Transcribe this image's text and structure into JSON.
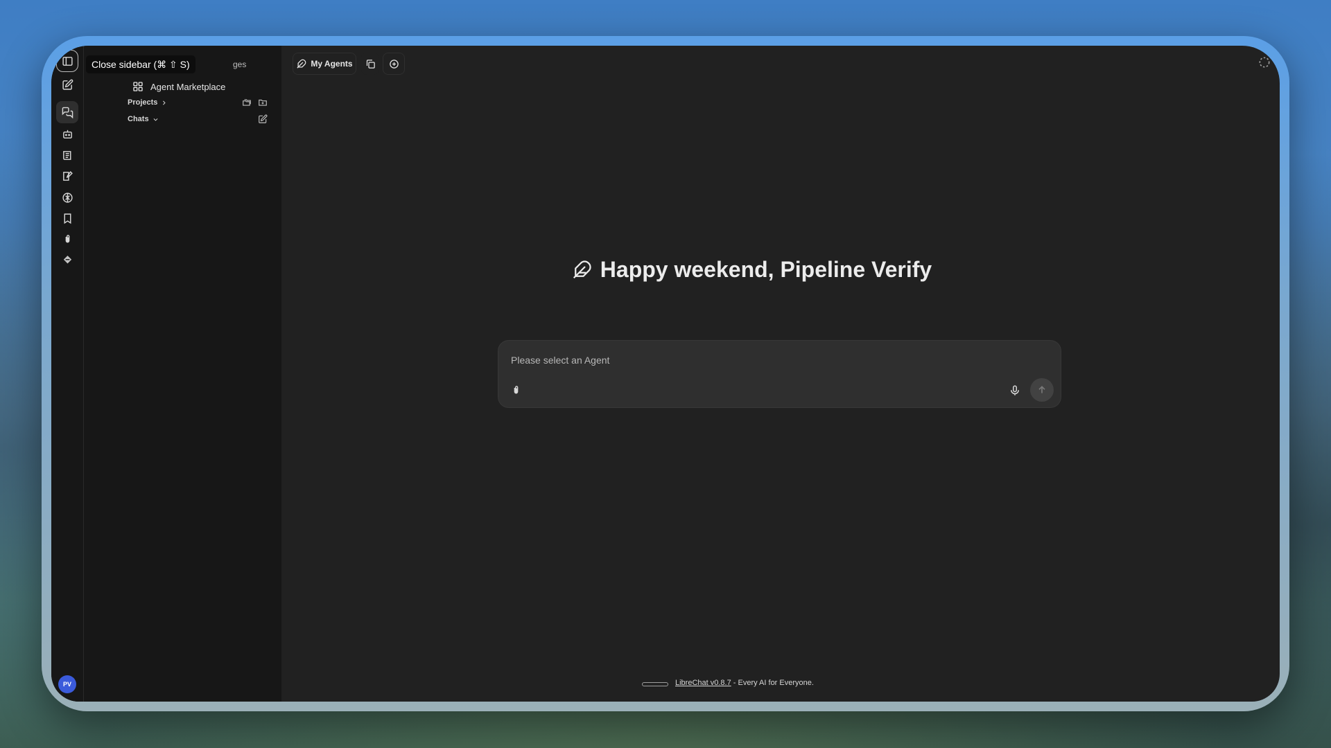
{
  "sidebar": {
    "tooltip": "Close sidebar (⌘ ⇧ S)",
    "tab_tail": "ges",
    "marketplace_label": "Agent Marketplace",
    "projects_label": "Projects",
    "chats_label": "Chats",
    "avatar_initials": "PV",
    "rail_icons": [
      "sidebar-toggle-icon",
      "new-chat-icon",
      "chats-icon",
      "agents-icon",
      "prompts-icon",
      "memories-icon",
      "mcp-icon",
      "bookmarks-icon",
      "attach-files-icon",
      "plugins-icon"
    ]
  },
  "topbar": {
    "agents_label": "My Agents"
  },
  "main": {
    "greeting": "Happy weekend, Pipeline Verify",
    "composer_placeholder": "Please select an Agent"
  },
  "footer": {
    "version_link": "LibreChat v0.8.7",
    "tagline": " - Every AI for Everyone."
  },
  "colors": {
    "background": "#212121",
    "sidebar": "#171717",
    "composer": "#2f2f2f",
    "avatar": "#3b5bdb"
  }
}
